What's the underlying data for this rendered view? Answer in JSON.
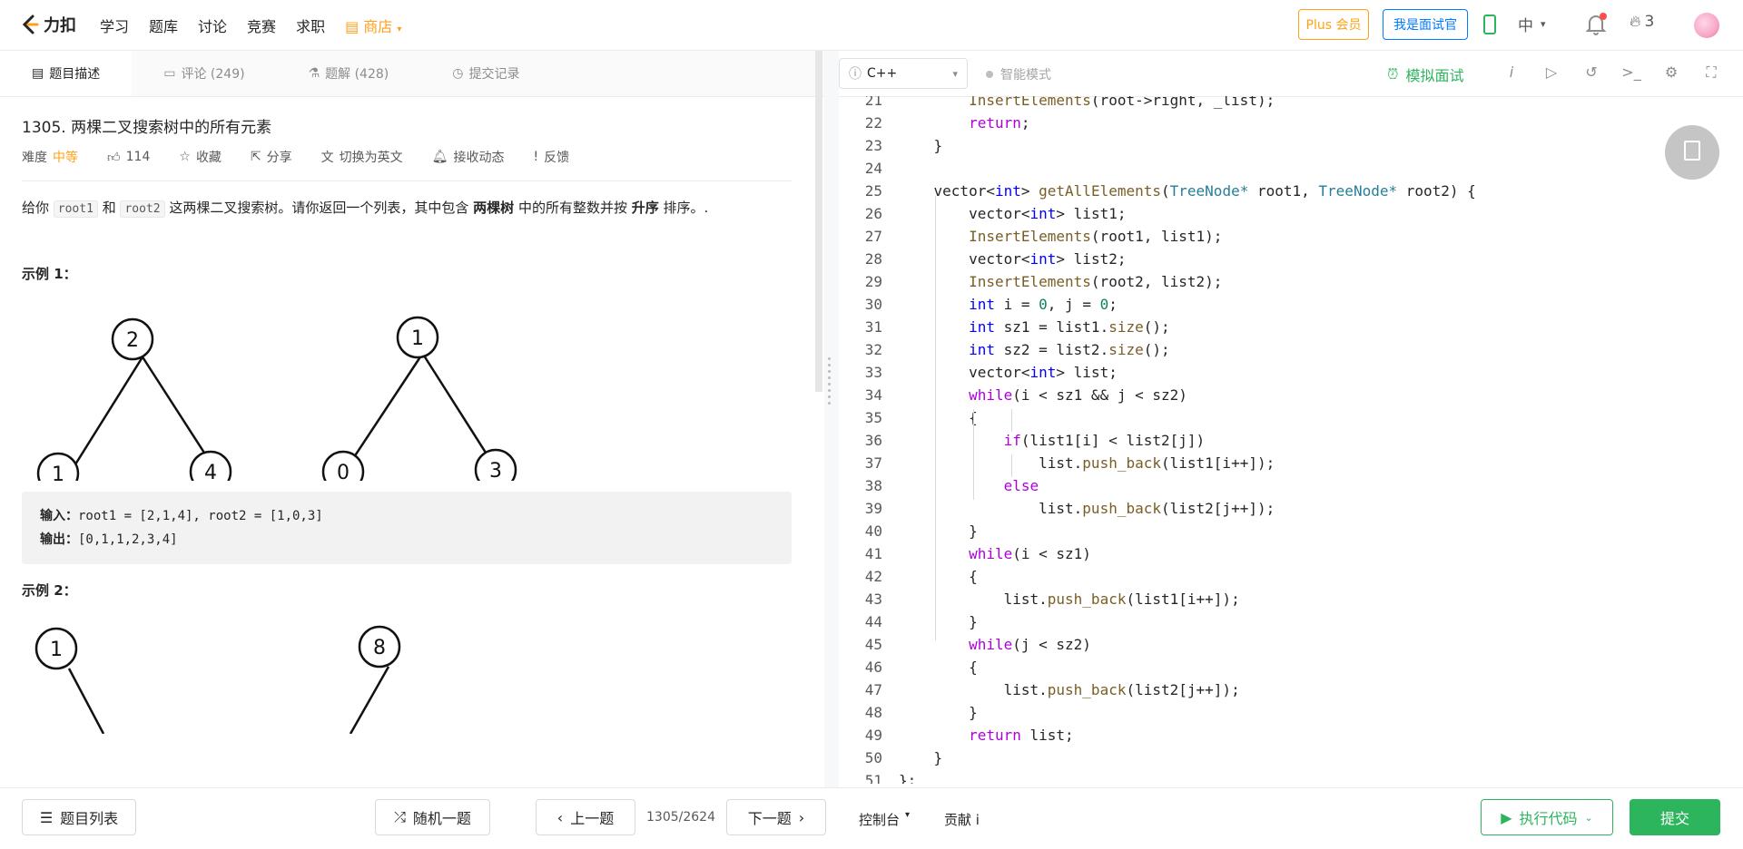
{
  "header": {
    "logo_text": "力扣",
    "nav": [
      "学习",
      "题库",
      "讨论",
      "竞赛",
      "求职"
    ],
    "store_label": "商店",
    "plus_label": "Plus 会员",
    "interviewer_label": "我是面试官",
    "lang_label": "中",
    "streak_count": "3"
  },
  "left_tabs": [
    {
      "label": "题目描述"
    },
    {
      "label": "评论 (249)"
    },
    {
      "label": "题解 (428)"
    },
    {
      "label": "提交记录"
    }
  ],
  "problem": {
    "title": "1305. 两棵二叉搜索树中的所有元素",
    "difficulty_label": "难度",
    "difficulty": "中等",
    "likes": "114",
    "collect": "收藏",
    "share": "分享",
    "switch_lang": "切换为英文",
    "subscribe": "接收动态",
    "feedback": "反馈",
    "desc_1": "给你 ",
    "code_1": "root1",
    "desc_2": " 和 ",
    "code_2": "root2",
    "desc_3": " 这两棵二叉搜索树。请你返回一个列表，其中包含 ",
    "bold_1": "两棵树",
    "desc_4": " 中的所有整数并按 ",
    "bold_2": "升序",
    "desc_5": " 排序。.",
    "example1_title": "示例 1：",
    "tree1": [
      "2",
      "1",
      "4"
    ],
    "tree2": [
      "1",
      "0",
      "3"
    ],
    "input_label": "输入：",
    "input_value": "root1 = [2,1,4], root2 = [1,0,3]",
    "output_label": "输出：",
    "output_value": "[0,1,1,2,3,4]",
    "example2_title": "示例 2：",
    "tree3": [
      "1"
    ],
    "tree4": [
      "8"
    ]
  },
  "editor": {
    "language": "C++",
    "smart_mode": "智能模式",
    "mock_interview": "模拟面试",
    "lines": [
      {
        "n": "21",
        "t": "        InsertElements(root->right, _list);"
      },
      {
        "n": "22",
        "t": "        return;"
      },
      {
        "n": "23",
        "t": "    }"
      },
      {
        "n": "24",
        "t": ""
      },
      {
        "n": "25",
        "t": "    vector<int> getAllElements(TreeNode* root1, TreeNode* root2) {"
      },
      {
        "n": "26",
        "t": "        vector<int> list1;"
      },
      {
        "n": "27",
        "t": "        InsertElements(root1, list1);"
      },
      {
        "n": "28",
        "t": "        vector<int> list2;"
      },
      {
        "n": "29",
        "t": "        InsertElements(root2, list2);"
      },
      {
        "n": "30",
        "t": "        int i = 0, j = 0;"
      },
      {
        "n": "31",
        "t": "        int sz1 = list1.size();"
      },
      {
        "n": "32",
        "t": "        int sz2 = list2.size();"
      },
      {
        "n": "33",
        "t": "        vector<int> list;"
      },
      {
        "n": "34",
        "t": "        while(i < sz1 && j < sz2)"
      },
      {
        "n": "35",
        "t": "        {"
      },
      {
        "n": "36",
        "t": "            if(list1[i] < list2[j])"
      },
      {
        "n": "37",
        "t": "                list.push_back(list1[i++]);"
      },
      {
        "n": "38",
        "t": "            else"
      },
      {
        "n": "39",
        "t": "                list.push_back(list2[j++]);"
      },
      {
        "n": "40",
        "t": "        }"
      },
      {
        "n": "41",
        "t": "        while(i < sz1)"
      },
      {
        "n": "42",
        "t": "        {"
      },
      {
        "n": "43",
        "t": "            list.push_back(list1[i++]);"
      },
      {
        "n": "44",
        "t": "        }"
      },
      {
        "n": "45",
        "t": "        while(j < sz2)"
      },
      {
        "n": "46",
        "t": "        {"
      },
      {
        "n": "47",
        "t": "            list.push_back(list2[j++]);"
      },
      {
        "n": "48",
        "t": "        }"
      },
      {
        "n": "49",
        "t": "        return list;"
      },
      {
        "n": "50",
        "t": "    }"
      },
      {
        "n": "51",
        "t": "};"
      }
    ]
  },
  "footer": {
    "problem_list": "题目列表",
    "random": "随机一题",
    "prev": "上一题",
    "page": "1305/2624",
    "next": "下一题",
    "console": "控制台",
    "contribute": "贡献 i",
    "run": "执行代码",
    "submit": "提交"
  },
  "colors": {
    "accent_green": "#2db55d",
    "accent_orange": "#ffa116",
    "accent_blue": "#007aff"
  }
}
